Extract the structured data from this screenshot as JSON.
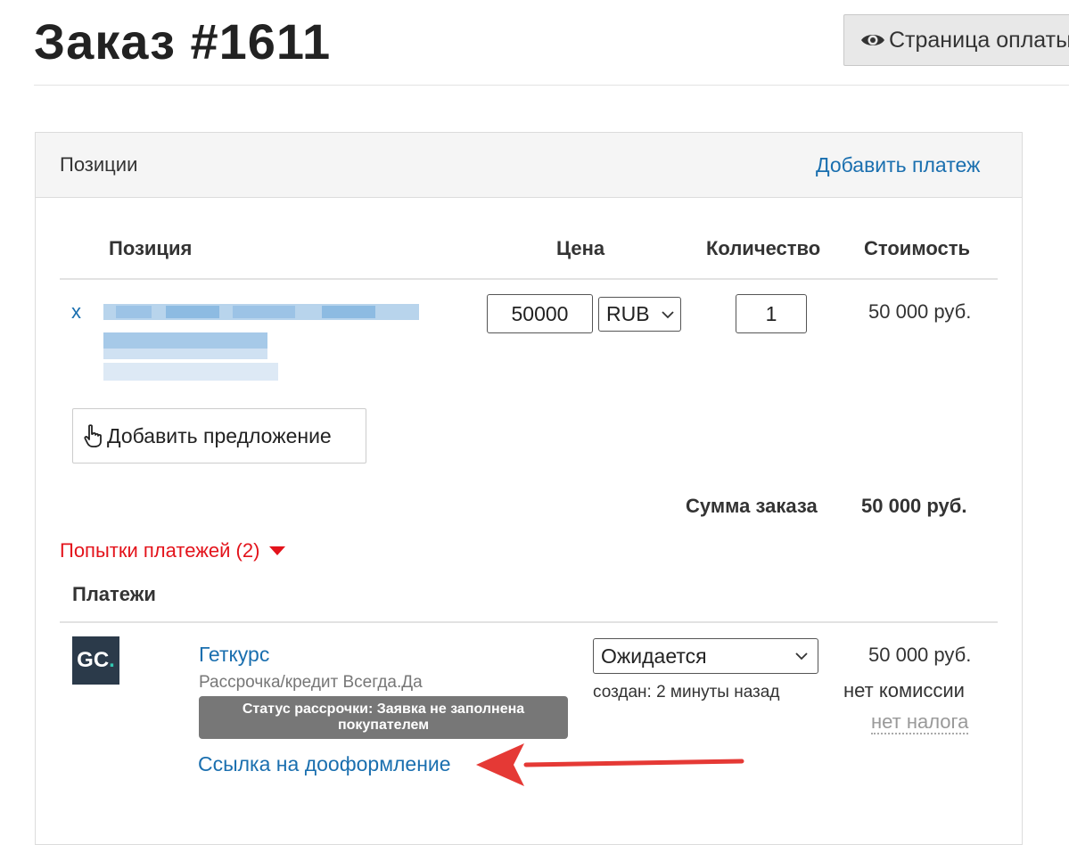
{
  "page": {
    "title": "Заказ #1611",
    "payment_page_button": "Страница оплаты"
  },
  "panel": {
    "title": "Позиции",
    "add_payment": "Добавить платеж"
  },
  "table": {
    "headers": {
      "position": "Позиция",
      "price": "Цена",
      "quantity": "Количество",
      "cost": "Стоимость"
    },
    "rows": [
      {
        "remove": "x",
        "price": "50000",
        "currency": "RUB",
        "quantity": "1",
        "cost": "50 000 руб."
      }
    ]
  },
  "add_offer_button": "Добавить предложение",
  "order_sum": {
    "label": "Сумма заказа",
    "value": "50 000 руб."
  },
  "payment_attempts": "Попытки платежей (2)",
  "payments": {
    "heading": "Платежи",
    "items": [
      {
        "logo_text": "GC",
        "logo_dot": ".",
        "provider": "Геткурс",
        "method": "Рассрочка/кредит Всегда.Да",
        "status_badge": "Статус рассрочки: Заявка не заполнена покупателем",
        "completion_link": "Ссылка на дооформление",
        "status": "Ожидается",
        "created": "создан: 2 минуты назад",
        "amount": "50 000 руб.",
        "fee": "нет комиссии",
        "tax": "нет налога"
      }
    ]
  },
  "colors": {
    "link": "#1a6faf",
    "attempts": "#e3131b",
    "badge_bg": "#777777",
    "logo_bg": "#2b3a4a",
    "logo_accent": "#32c6b0",
    "arrow": "#e53935"
  },
  "icons": {
    "payment_page": "eye-icon",
    "add_offer": "pointing-hand-icon",
    "attempts_toggle": "caret-down-icon",
    "select": "chevron-down-icon"
  }
}
